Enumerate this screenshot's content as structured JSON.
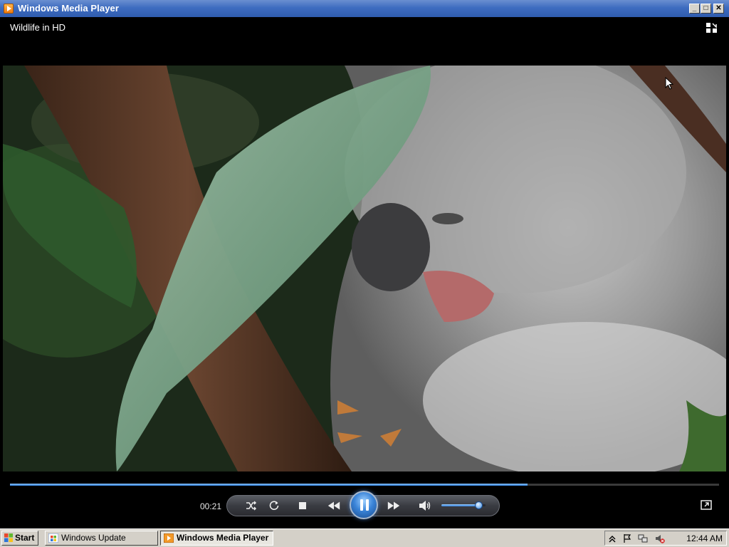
{
  "window": {
    "title": "Windows Media Player",
    "buttons": {
      "minimize": "_",
      "maximize": "□",
      "close": "✕"
    }
  },
  "now_playing": {
    "title": "Wildlife in HD"
  },
  "playback": {
    "time": "00:21",
    "progress": 0.73,
    "volume": 0.85,
    "state": "playing"
  },
  "icons": {
    "layout": "switch-layout-icon",
    "shuffle": "shuffle-icon",
    "repeat": "repeat-icon",
    "stop": "stop-icon",
    "previous": "previous-icon",
    "pause": "pause-icon",
    "next": "next-icon",
    "mute": "speaker-icon",
    "fullscreen": "fullscreen-icon"
  },
  "colors": {
    "seek_fill": "#2a7ad8",
    "title_bar": "#3e6cc0"
  },
  "taskbar": {
    "start_label": "Start",
    "tasks": [
      {
        "label": "Windows Update",
        "active": false
      },
      {
        "label": "Windows Media Player",
        "active": true
      }
    ],
    "clock": "12:44 AM"
  }
}
